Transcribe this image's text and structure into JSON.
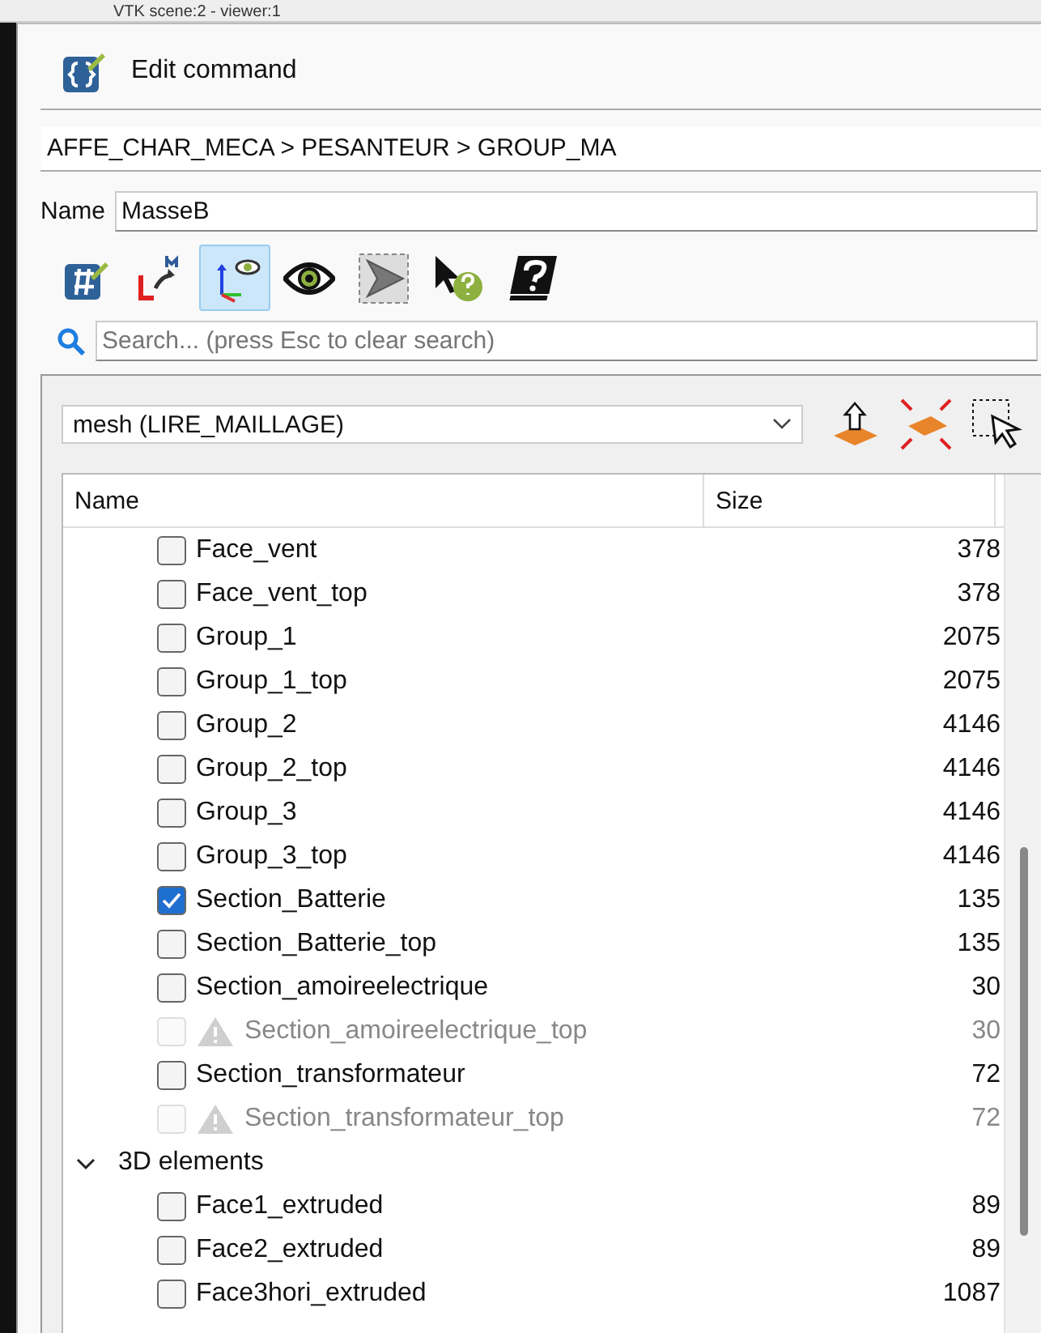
{
  "background_window": {
    "title": "VTK scene:2 - viewer:1"
  },
  "dialog": {
    "title": "Edit command"
  },
  "breadcrumb": "AFFE_CHAR_MECA > PESANTEUR > GROUP_MA",
  "name_field": {
    "label": "Name",
    "value": "MasseB"
  },
  "toolbar": [
    {
      "kind": "hash",
      "selected": false
    },
    {
      "kind": "local",
      "selected": false
    },
    {
      "kind": "axes",
      "selected": true
    },
    {
      "kind": "eye",
      "selected": false
    },
    {
      "kind": "mesh",
      "selected": false
    },
    {
      "kind": "whatsthis",
      "selected": false
    },
    {
      "kind": "help",
      "selected": false
    }
  ],
  "search": {
    "placeholder": "Search... (press Esc to clear search)"
  },
  "mesh_select": {
    "value": "mesh (LIRE_MAILLAGE)"
  },
  "tree": {
    "columns": [
      "Name",
      "Size"
    ],
    "items": [
      {
        "label": "Face_vent",
        "size": "378",
        "checked": false,
        "disabled": false
      },
      {
        "label": "Face_vent_top",
        "size": "378",
        "checked": false,
        "disabled": false
      },
      {
        "label": "Group_1",
        "size": "2075",
        "checked": false,
        "disabled": false
      },
      {
        "label": "Group_1_top",
        "size": "2075",
        "checked": false,
        "disabled": false
      },
      {
        "label": "Group_2",
        "size": "4146",
        "checked": false,
        "disabled": false
      },
      {
        "label": "Group_2_top",
        "size": "4146",
        "checked": false,
        "disabled": false
      },
      {
        "label": "Group_3",
        "size": "4146",
        "checked": false,
        "disabled": false
      },
      {
        "label": "Group_3_top",
        "size": "4146",
        "checked": false,
        "disabled": false
      },
      {
        "label": "Section_Batterie",
        "size": "135",
        "checked": true,
        "disabled": false
      },
      {
        "label": "Section_Batterie_top",
        "size": "135",
        "checked": false,
        "disabled": false
      },
      {
        "label": "Section_amoireelectrique",
        "size": "30",
        "checked": false,
        "disabled": false
      },
      {
        "label": "Section_amoireelectrique_top",
        "size": "30",
        "checked": false,
        "disabled": true
      },
      {
        "label": "Section_transformateur",
        "size": "72",
        "checked": false,
        "disabled": false
      },
      {
        "label": "Section_transformateur_top",
        "size": "72",
        "checked": false,
        "disabled": true
      },
      {
        "label": "3D elements",
        "expanded": true,
        "children": [
          {
            "label": "Face1_extruded",
            "size": "89",
            "checked": false,
            "disabled": false
          },
          {
            "label": "Face2_extruded",
            "size": "89",
            "checked": false,
            "disabled": false
          },
          {
            "label": "Face3hori_extruded",
            "size": "1087",
            "checked": false,
            "disabled": false
          }
        ]
      }
    ]
  }
}
